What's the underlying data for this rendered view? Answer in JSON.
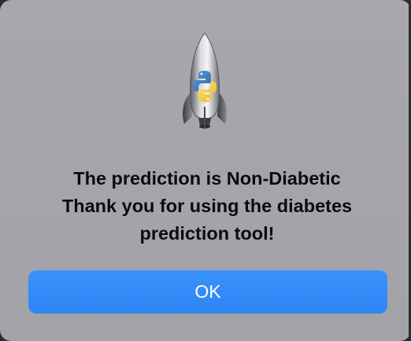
{
  "dialog": {
    "message_lines": [
      "The prediction is Non-Diabetic",
      "Thank you for using the diabetes",
      "prediction tool!"
    ],
    "ok_label": "OK",
    "app_icon": "python-launcher-rocket-icon"
  },
  "colors": {
    "dialog_background": "#a5a6ac",
    "button_accent": "#3489f8",
    "button_text": "#ffffff",
    "message_text": "#0b0b0c"
  }
}
